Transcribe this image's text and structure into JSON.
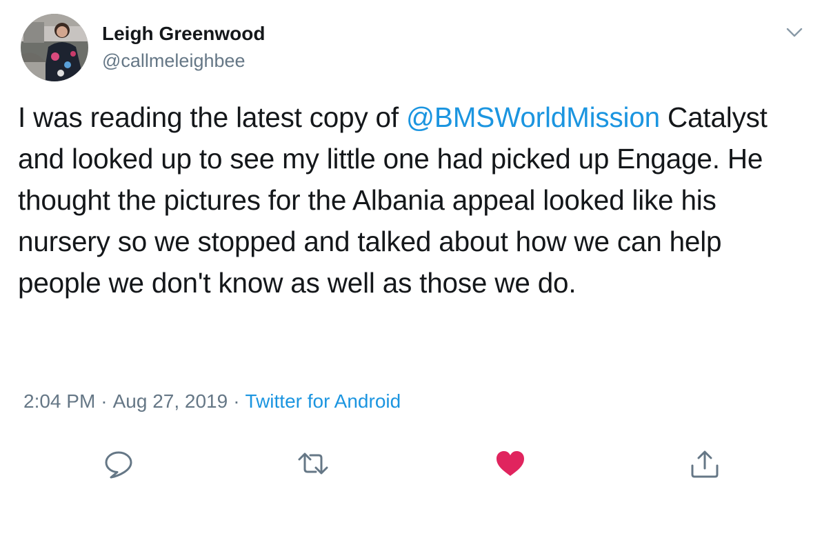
{
  "author": {
    "display_name": "Leigh Greenwood",
    "handle": "@callmeleighbee",
    "avatar": "avatar-photo"
  },
  "tweet": {
    "mention": "@BMSWorldMission",
    "text_before_mention": "I was reading the latest copy of ",
    "text_after_mention": " Catalyst and looked up to see my little one had picked up Engage. He thought the pictures for the Albania appeal looked like his nursery so we stopped and talked about how we can help people we don't know as well as those we do."
  },
  "meta": {
    "time": "2:04 PM",
    "separator": "·",
    "date": "Aug 27, 2019",
    "source": "Twitter for Android"
  },
  "actions": [
    {
      "name": "reply",
      "icon": "reply-icon"
    },
    {
      "name": "retweet",
      "icon": "retweet-icon"
    },
    {
      "name": "like",
      "icon": "heart-icon",
      "state": "liked"
    },
    {
      "name": "share",
      "icon": "share-icon"
    }
  ],
  "colors": {
    "link": "#1b95e0",
    "secondary_text": "#657786",
    "primary_text": "#14171a",
    "like_red": "#e0245e"
  }
}
